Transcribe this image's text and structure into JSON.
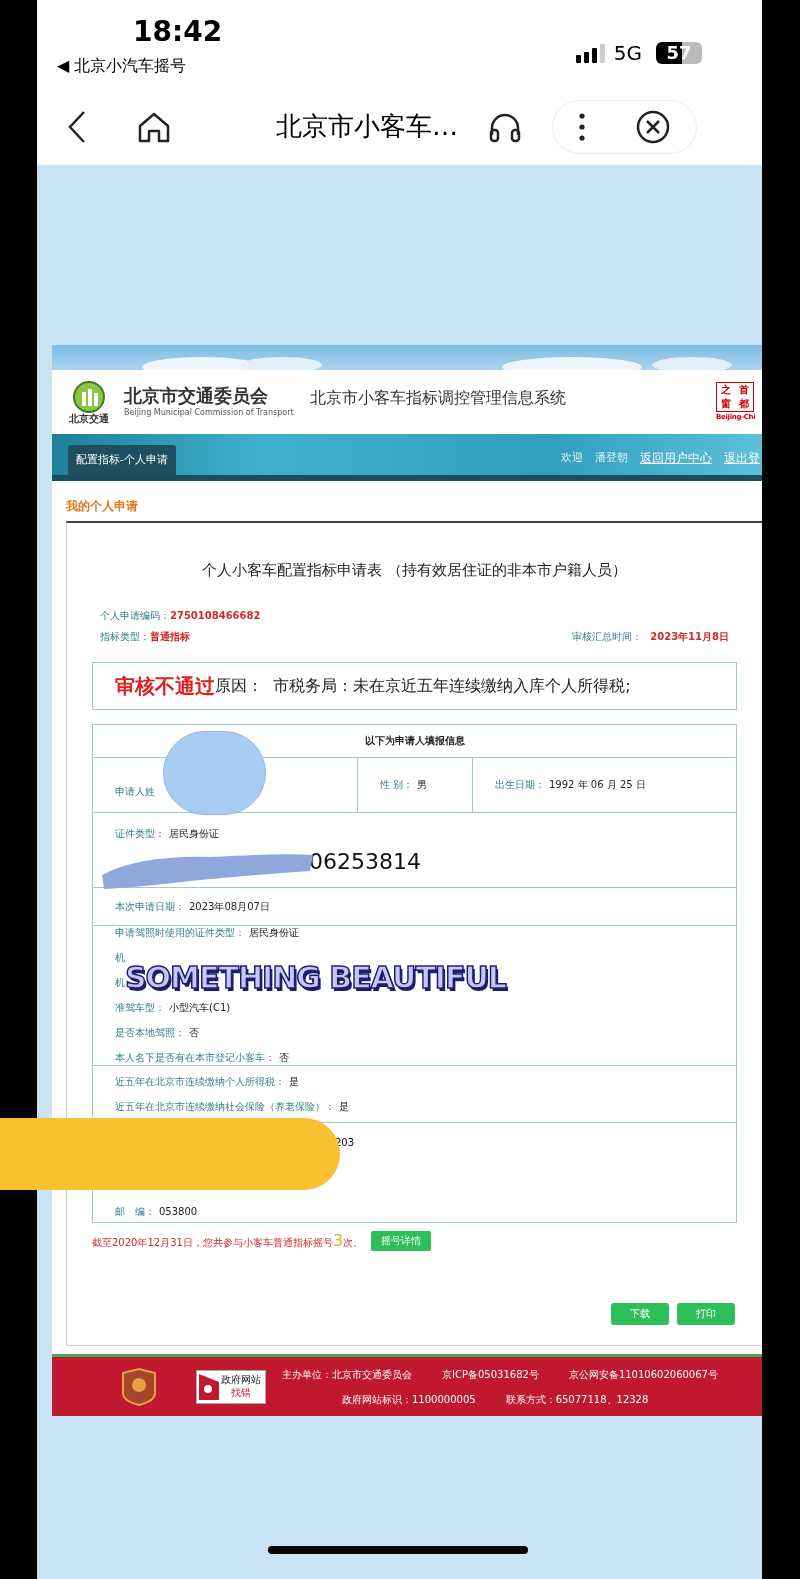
{
  "status_bar": {
    "time": "18:42",
    "back_label": "◀ 北京小汽车摇号",
    "network": "5G",
    "battery": "57"
  },
  "browser_bar": {
    "title": "北京市小客车…"
  },
  "site_header": {
    "logo_text": "北京交通",
    "org_name": "北京市交通委员会",
    "org_name_en": "Beijing Municipal Commission of Transport",
    "system_name": "北京市小客车指标调控管理信息系统",
    "portal_logo": [
      "之",
      "首",
      "窗",
      "都"
    ],
    "portal_caption": "Beijing-Chi"
  },
  "nav": {
    "tab": "配置指标-个人申请",
    "greeting": "欢迎",
    "user": "潘登朝",
    "links": [
      "返回用户中心",
      "退出登"
    ]
  },
  "section_title": "我的个人申请",
  "form": {
    "title": "个人小客车配置指标申请表 （持有效居住证的非本市户籍人员）",
    "meta_left": [
      {
        "label": "个人申请编码：",
        "value": "2750108466682"
      },
      {
        "label": "指标类型：",
        "value": "普通指标"
      }
    ],
    "meta_right": {
      "label": "审核汇总时间：",
      "value": "2023年11月8日"
    },
    "review": {
      "verdict": "审核不通过",
      "reason": "原因：  市税务局：未在京近五年连续缴纳入库个人所得税;"
    },
    "table_heading": "以下为申请人填报信息",
    "sections": [
      {
        "kind": "cells",
        "lines": [
          {
            "kind": "field",
            "label": "申请人姓"
          },
          {
            "kind": "field",
            "label": "性 别：",
            "value": "男"
          },
          {
            "kind": "field",
            "label": "出生日期：",
            "value": "1992 年 06 月 25 日"
          }
        ]
      },
      {
        "kind": "lines",
        "lines": [
          {
            "kind": "field",
            "label": "证件类型：",
            "value": "居民身份证"
          },
          {
            "kind": "number",
            "value": "06253814"
          }
        ]
      },
      {
        "kind": "lines",
        "lines": [
          {
            "kind": "field",
            "label": "本次申请日期：",
            "value": "2023年08月07日"
          }
        ]
      },
      {
        "kind": "lines",
        "lines": [
          {
            "kind": "field",
            "label": "申请驾照时使用的证件类型：",
            "value": "居民身份证"
          },
          {
            "kind": "field",
            "label": "机"
          },
          {
            "kind": "field",
            "label": "机"
          },
          {
            "kind": "field",
            "label": "准驾车型：",
            "value": "小型汽车(C1)"
          },
          {
            "kind": "field",
            "label": "是否本地驾照：",
            "value": "否"
          },
          {
            "kind": "field",
            "label": "本人名下是否有在本市登记小客车：",
            "value": "否"
          }
        ]
      },
      {
        "kind": "lines",
        "lines": [
          {
            "kind": "field",
            "label": "近五年在北京市连续缴纳个人所得税：",
            "value": "是"
          },
          {
            "kind": "field",
            "label": "近五年在北京市连续缴纳社会保险（养老保险）：",
            "value": "是"
          }
        ]
      },
      {
        "kind": "covered",
        "lines": [
          {
            "kind": "tail",
            "value": "203"
          },
          {
            "kind": "field",
            "label": "邮　编：",
            "value": "053800"
          }
        ]
      }
    ],
    "lottery": {
      "prefix": "截至2020年12月31日，您共参与小客车普通指标摇号",
      "count": "3",
      "suffix": "次。",
      "button": "摇号详情"
    },
    "actions": [
      "下载",
      "打印"
    ]
  },
  "footer": {
    "badge": [
      "政府网站",
      "找错"
    ],
    "lines": [
      [
        "主办单位：北京市交通委员会",
        "京ICP备05031682号",
        "京公网安备11010602060067号"
      ],
      [
        "政府网站标识：1100000005",
        "联系方式：65077118、12328"
      ]
    ]
  },
  "sticker": {
    "caption": "SOMETHING BEAUTIFUL"
  }
}
